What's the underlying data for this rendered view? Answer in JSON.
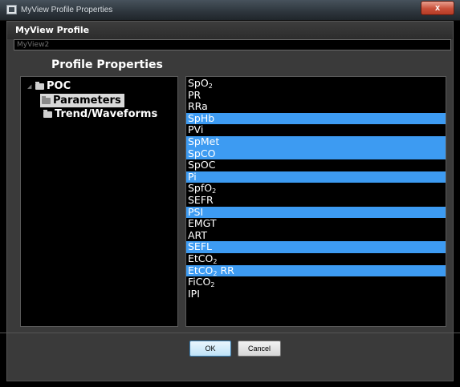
{
  "window": {
    "title": "MyView Profile Properties",
    "close_label": "x"
  },
  "header": {
    "title": "MyView Profile",
    "profile_name": "MyView2"
  },
  "section_title": "Profile Properties",
  "tree": {
    "root": "POC",
    "items": [
      "Parameters",
      "Trend/Waveforms"
    ],
    "selected": "Parameters"
  },
  "parameters": [
    {
      "label": "SpO",
      "sub": "2",
      "highlighted": false
    },
    {
      "label": "PR",
      "sub": "",
      "highlighted": false
    },
    {
      "label": "RRa",
      "sub": "",
      "highlighted": false
    },
    {
      "label": "SpHb",
      "sub": "",
      "highlighted": true
    },
    {
      "label": "PVi",
      "sub": "",
      "highlighted": false
    },
    {
      "label": "SpMet",
      "sub": "",
      "highlighted": true
    },
    {
      "label": "SpCO",
      "sub": "",
      "highlighted": true
    },
    {
      "label": "SpOC",
      "sub": "",
      "highlighted": false
    },
    {
      "label": "Pi",
      "sub": "",
      "highlighted": true
    },
    {
      "label": "SpfO",
      "sub": "2",
      "highlighted": false
    },
    {
      "label": "SEFR",
      "sub": "",
      "highlighted": false
    },
    {
      "label": "PSI",
      "sub": "",
      "highlighted": true
    },
    {
      "label": "EMGT",
      "sub": "",
      "highlighted": false
    },
    {
      "label": "ART",
      "sub": "",
      "highlighted": false
    },
    {
      "label": "SEFL",
      "sub": "",
      "highlighted": true
    },
    {
      "label": "EtCO",
      "sub": "2",
      "highlighted": false
    },
    {
      "label": "EtCO",
      "sub": "2",
      "suffix": " RR",
      "highlighted": true
    },
    {
      "label": "FiCO",
      "sub": "2",
      "highlighted": false
    },
    {
      "label": "IPI",
      "sub": "",
      "highlighted": false
    }
  ],
  "buttons": {
    "ok": "OK",
    "cancel": "Cancel"
  },
  "colors": {
    "highlight": "#3d9bf2",
    "background": "#000000",
    "panel": "#3a3a3a"
  }
}
